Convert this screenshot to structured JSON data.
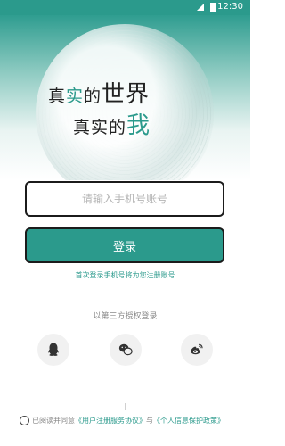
{
  "status_bar": {
    "time": "12:30"
  },
  "hero": {
    "slogan_line1": {
      "pre": "真",
      "accent": "实",
      "mid": "的",
      "big": "世界"
    },
    "slogan_line2": {
      "pre": "真实的",
      "big_accent": "我"
    }
  },
  "login": {
    "phone_placeholder": "请输入手机号账号",
    "phone_value": "",
    "login_button": "登录",
    "register_hint": "首次登录手机号将为您注册账号"
  },
  "third_party": {
    "label": "以第三方授权登录",
    "providers": [
      {
        "name": "QQ",
        "icon": "qq-icon"
      },
      {
        "name": "WeChat",
        "icon": "wechat-icon"
      },
      {
        "name": "Weibo",
        "icon": "weibo-icon"
      }
    ]
  },
  "agreement": {
    "prefix": "已阅读并同意",
    "link1": "《用户注册服务协议》",
    "conjunction": "与",
    "link2": "《个人信息保护政策》"
  },
  "colors": {
    "accent": "#2b9a8c",
    "border": "#1b1b1b"
  }
}
